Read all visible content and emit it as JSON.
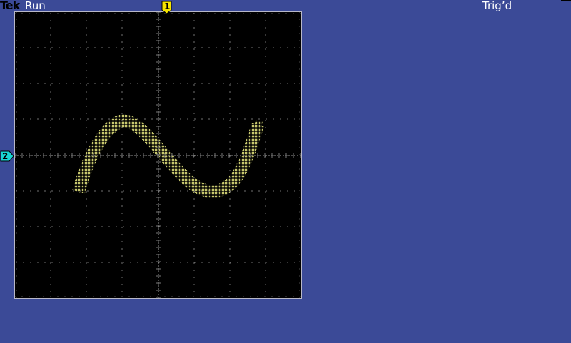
{
  "header": {
    "brand": "Tek",
    "acquisition_state": "Run",
    "trigger_state": "Trig’d"
  },
  "markers": {
    "channel1": {
      "label": "1",
      "color": "#f5e400"
    },
    "channel2": {
      "label": "2",
      "color": "#19d4d4"
    }
  },
  "display": {
    "mode": "XY",
    "background": "#000000",
    "graticule_color": "#9a9a9a",
    "trace_color": "#c8c86e",
    "divisions": {
      "horizontal": 8,
      "vertical": 8
    }
  }
}
